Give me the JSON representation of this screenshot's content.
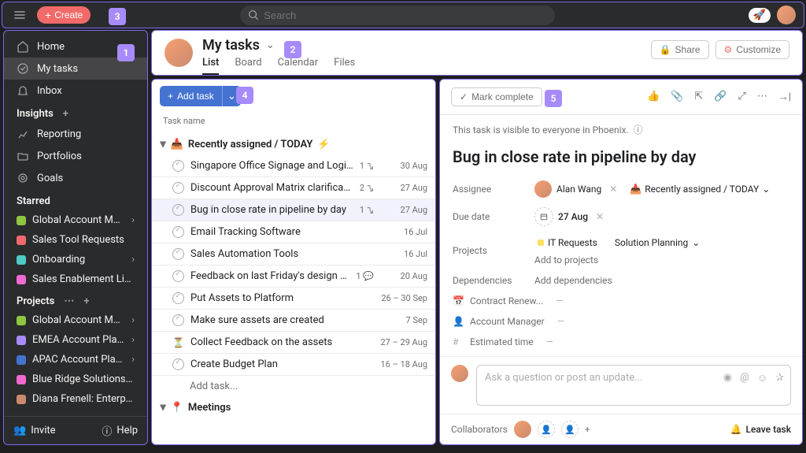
{
  "topbar": {
    "create": "Create",
    "search_placeholder": "Search"
  },
  "sidebar": {
    "nav": [
      {
        "label": "Home",
        "icon": "home"
      },
      {
        "label": "My tasks",
        "icon": "check",
        "active": true
      },
      {
        "label": "Inbox",
        "icon": "bell"
      }
    ],
    "insights_label": "Insights",
    "insights": [
      {
        "label": "Reporting",
        "icon": "chart"
      },
      {
        "label": "Portfolios",
        "icon": "folder"
      },
      {
        "label": "Goals",
        "icon": "target"
      }
    ],
    "starred_label": "Starred",
    "starred": [
      {
        "label": "Global Account Man...",
        "color": "#8ec63f",
        "chevron": true
      },
      {
        "label": "Sales Tool Requests",
        "color": "#f06a6a"
      },
      {
        "label": "Onboarding",
        "color": "#4ecbc4",
        "chevron": true
      },
      {
        "label": "Sales Enablement Library",
        "color": "#f06ad0"
      }
    ],
    "projects_label": "Projects",
    "projects": [
      {
        "label": "Global Account Man...",
        "color": "#8ec63f",
        "chevron": true
      },
      {
        "label": "EMEA Account Plans",
        "color": "#a78bfa",
        "chevron": true
      },
      {
        "label": "APAC Account Plans",
        "color": "#4573d2",
        "chevron": true
      },
      {
        "label": "Blue Ridge Solutions - A...",
        "color": "#f06ad0"
      },
      {
        "label": "Diana Frenell: Enterprise...",
        "color": "#c98a6e"
      }
    ],
    "invite": "Invite",
    "help": "Help"
  },
  "header": {
    "title": "My tasks",
    "tabs": [
      "List",
      "Board",
      "Calendar",
      "Files"
    ],
    "active_tab": "List",
    "share": "Share",
    "customize": "Customize"
  },
  "list": {
    "add_task": "Add task",
    "col_name": "Task name",
    "sections": [
      {
        "title": "Recently assigned / TODAY",
        "emoji_left": "📥",
        "emoji_right": "⚡",
        "tasks": [
          {
            "title": "Singapore Office Signage and Logistics",
            "sub": "1",
            "date": "30 Aug"
          },
          {
            "title": "Discount Approval Matrix clarification",
            "sub": "2",
            "date": "27 Aug"
          },
          {
            "title": "Bug in close rate in pipeline by day",
            "sub": "1",
            "date": "27 Aug",
            "selected": true
          },
          {
            "title": "Email Tracking Software",
            "date": "16 Jul"
          },
          {
            "title": "Sales Automation Tools",
            "date": "16 Jul"
          },
          {
            "title": "Feedback on last Friday's design team pres",
            "comments": "1",
            "date": "20 Aug"
          },
          {
            "title": "Put Assets to Platform",
            "date": "26 – 30 Sep"
          },
          {
            "title": "Make sure assets are created",
            "date": "7 Sep"
          },
          {
            "title": "Collect Feedback on the assets",
            "hourglass": true,
            "date": "27 – 29 Aug"
          },
          {
            "title": "Create Budget Plan",
            "date": "16 – 18 Aug"
          }
        ],
        "add_inline": "Add task..."
      },
      {
        "title": "Meetings",
        "emoji_left": "📍"
      }
    ]
  },
  "detail": {
    "mark_complete": "Mark complete",
    "visibility": "This task is visible to everyone in Phoenix.",
    "title": "Bug in close rate in pipeline by day",
    "fields": {
      "assignee_label": "Assignee",
      "assignee_name": "Alan Wang",
      "section": "Recently assigned / TODAY",
      "duedate_label": "Due date",
      "duedate": "27 Aug",
      "projects_label": "Projects",
      "project1": "IT Requests",
      "project2": "Solution Planning",
      "add_projects": "Add to projects",
      "deps_label": "Dependencies",
      "add_deps": "Add dependencies"
    },
    "custom_fields": [
      {
        "icon": "calendar",
        "label": "Contract Renew..."
      },
      {
        "icon": "person",
        "label": "Account Manager"
      },
      {
        "icon": "hash",
        "label": "Estimated time"
      }
    ],
    "comment_placeholder": "Ask a question or post an update...",
    "collaborators_label": "Collaborators",
    "leave": "Leave task"
  },
  "callouts": {
    "c1": "1",
    "c2": "2",
    "c3": "3",
    "c4": "4",
    "c5": "5"
  }
}
